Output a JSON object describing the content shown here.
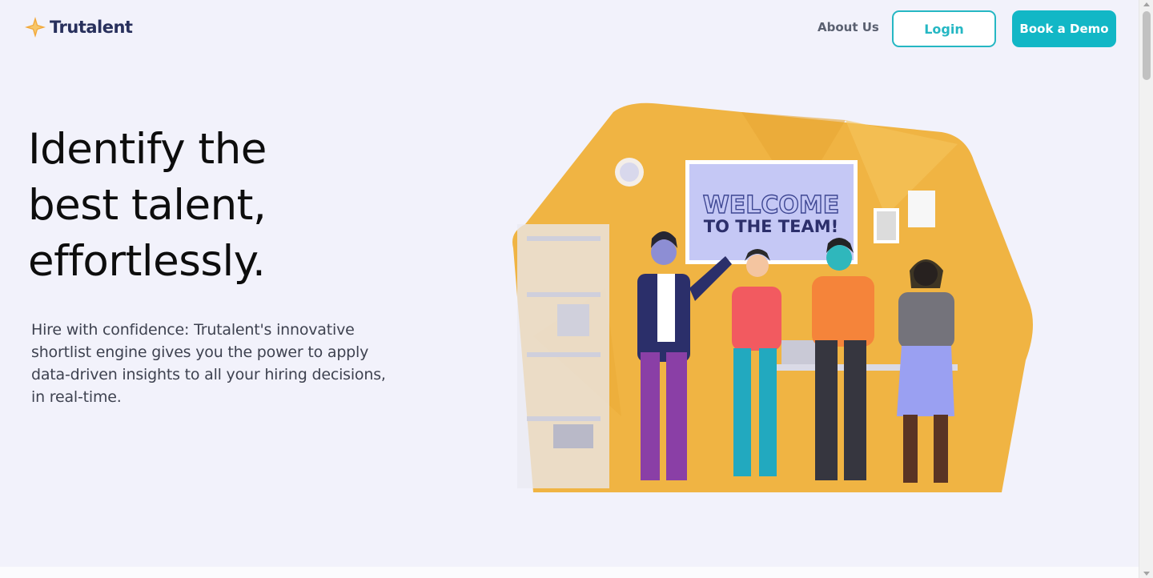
{
  "header": {
    "brand": "Trutalent",
    "nav_about": "About Us",
    "login_label": "Login",
    "demo_label": "Book a Demo"
  },
  "hero": {
    "title_line1": "Identify the",
    "title_line2": "best talent,",
    "title_line3": "effortlessly.",
    "subtitle": "Hire with confidence: Trutalent's innovative shortlist engine gives you the power to apply data-driven insights to all your hiring decisions, in real-time."
  },
  "illustration": {
    "banner_line1": "WELCOME",
    "banner_line2": "TO THE TEAM!"
  },
  "colors": {
    "accent": "#12b7c6",
    "brand_text": "#28305c",
    "logo_star": "#f2a93b",
    "illustration_bg": "#f0b443",
    "page_bg": "#f2f2fb"
  }
}
